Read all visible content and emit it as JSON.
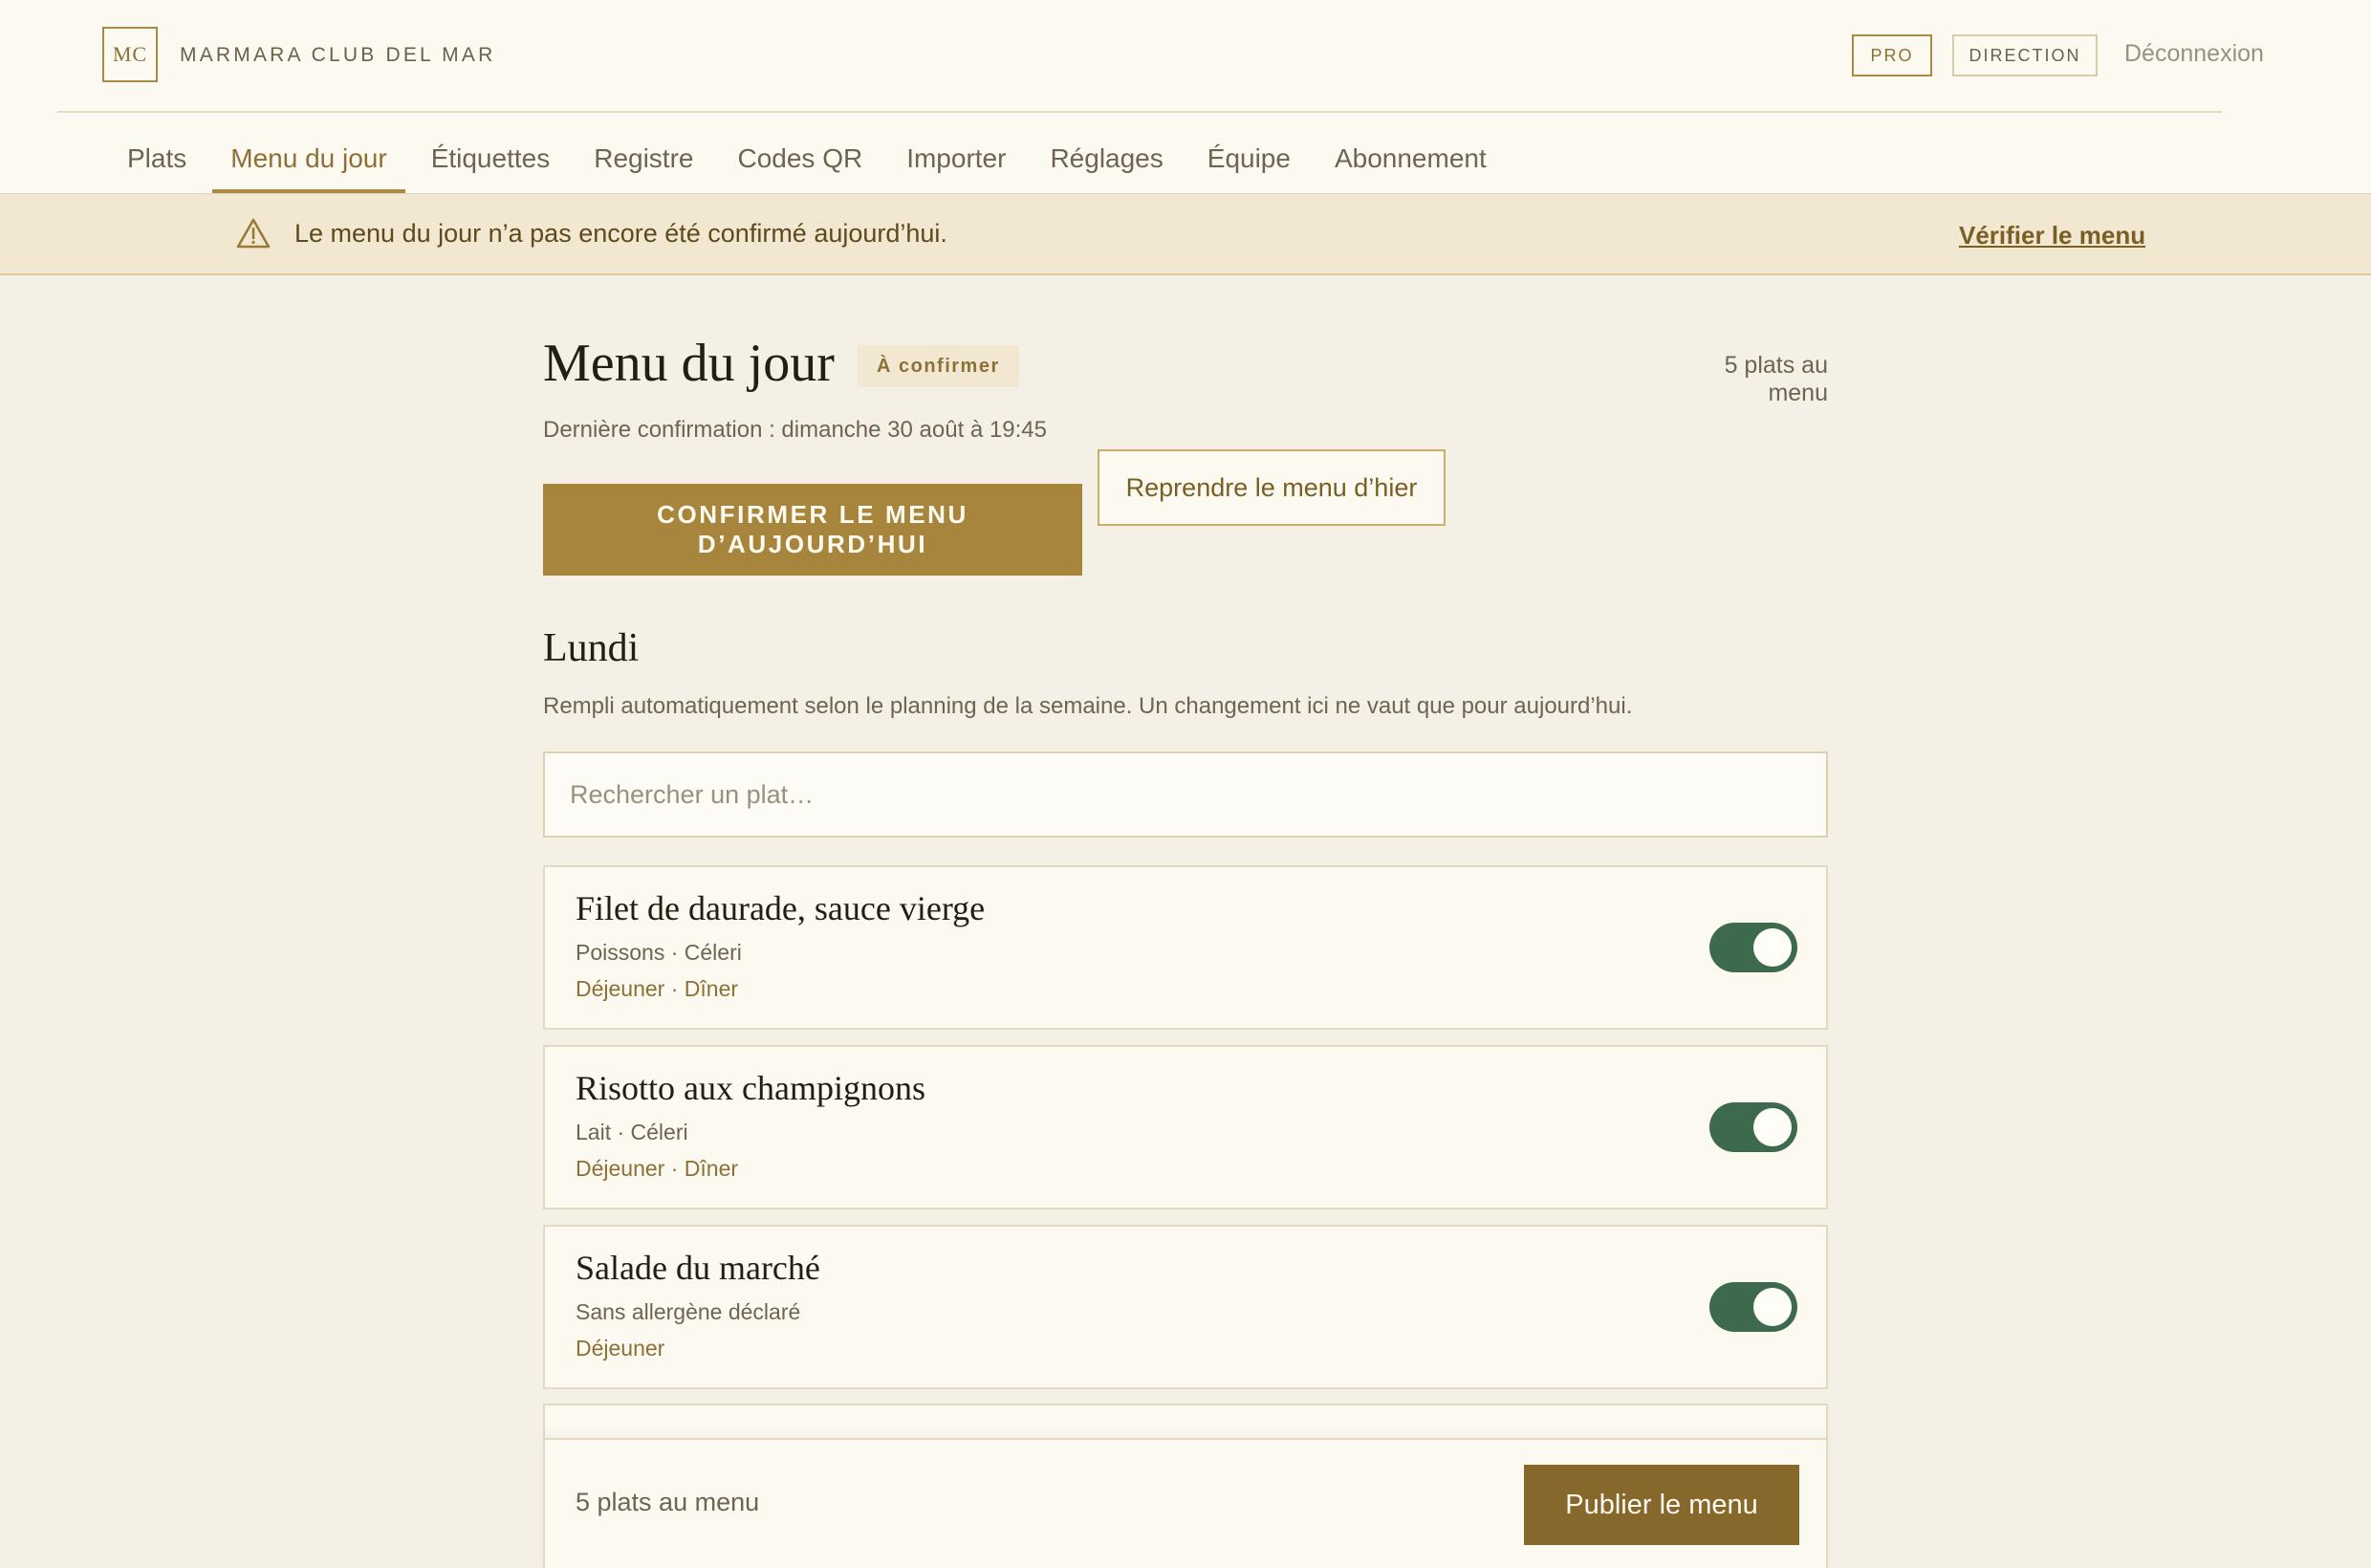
{
  "header": {
    "logo_initials": "MC",
    "brand": "MARMARA CLUB DEL MAR",
    "badge_pro": "PRO",
    "badge_direction": "DIRECTION",
    "logout_label": "Déconnexion"
  },
  "nav": {
    "items": [
      {
        "label": "Plats"
      },
      {
        "label": "Menu du jour",
        "active": true
      },
      {
        "label": "Étiquettes"
      },
      {
        "label": "Registre"
      },
      {
        "label": "Codes QR"
      },
      {
        "label": "Importer"
      },
      {
        "label": "Réglages"
      },
      {
        "label": "Équipe"
      },
      {
        "label": "Abonnement"
      }
    ]
  },
  "alert": {
    "icon": "warning-triangle-icon",
    "message": "Le menu du jour n’a pas encore été confirmé aujourd’hui.",
    "link_label": "Vérifier le menu"
  },
  "main": {
    "title": "Menu du jour",
    "status_chip": "À confirmer",
    "dish_count": "5 plats au menu",
    "last_confirmation": "Dernière confirmation : dimanche 30 août à 19:45",
    "confirm_button": "CONFIRMER LE MENU D’AUJOURD’HUI",
    "yesterday_button": "Reprendre le menu d’hier",
    "day_title": "Lundi",
    "day_hint": "Rempli automatiquement selon le planning de la semaine. Un changement ici ne vaut que pour aujourd’hui.",
    "search_placeholder": "Rechercher un plat…",
    "dishes": [
      {
        "name": "Filet de daurade, sauce vierge",
        "allergens": "Poissons · Céleri",
        "meals": "Déjeuner · Dîner",
        "enabled": true
      },
      {
        "name": "Risotto aux champignons",
        "allergens": "Lait · Céleri",
        "meals": "Déjeuner · Dîner",
        "enabled": true
      },
      {
        "name": "Salade du marché",
        "allergens": "Sans allergène déclaré",
        "meals": "Déjeuner",
        "enabled": true
      }
    ]
  },
  "footer": {
    "dish_count": "5 plats au menu",
    "publish_button": "Publier le menu"
  },
  "colors": {
    "accent_gold": "#a8853d",
    "toggle_on": "#3d6a4c",
    "background": "#f4f0e6",
    "alert_bg": "#f2e8d2"
  }
}
